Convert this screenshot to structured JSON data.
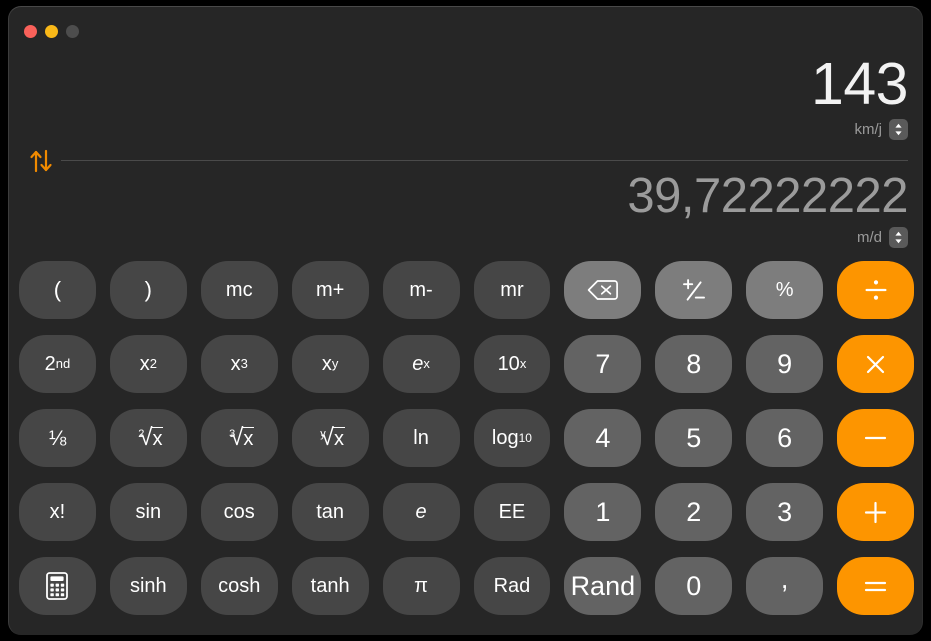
{
  "window": {
    "traffic_lights": [
      {
        "name": "close",
        "color": "#f9615a",
        "label": "Close"
      },
      {
        "name": "minimize",
        "color": "#f9b818",
        "label": "Minimize"
      },
      {
        "name": "zoom",
        "color": "#4d4d4d",
        "label": "Zoom"
      }
    ]
  },
  "display": {
    "primary": {
      "value": "143",
      "unit": "km/j"
    },
    "secondary": {
      "value": "39,72222222",
      "unit": "m/d"
    },
    "swap_icon": "swap-vertical-arrows-icon"
  },
  "colors": {
    "accent_orange": "#fd9500",
    "swap_arrow_orange": "#f08a00",
    "window_background": "#262626",
    "key_function": "#464646",
    "key_utility": "#7d7d7d",
    "key_number": "#636363",
    "primary_text": "#f2f2f2",
    "secondary_text": "#9b9b9b",
    "unit_text": "#9a9a9a"
  },
  "keypad": {
    "rows": [
      [
        {
          "id": "open-paren",
          "label": "(",
          "kind": "fn",
          "style": "paren"
        },
        {
          "id": "close-paren",
          "label": ")",
          "kind": "fn",
          "style": "paren"
        },
        {
          "id": "mc",
          "label": "mc",
          "kind": "fn"
        },
        {
          "id": "m-plus",
          "label": "m+",
          "kind": "fn"
        },
        {
          "id": "m-minus",
          "label": "m-",
          "kind": "fn"
        },
        {
          "id": "mr",
          "label": "mr",
          "kind": "fn"
        },
        {
          "id": "delete",
          "label": "",
          "kind": "util",
          "icon": "backspace-icon"
        },
        {
          "id": "plus-minus",
          "label": "",
          "kind": "util",
          "icon": "plus-minus-icon"
        },
        {
          "id": "percent",
          "label": "%",
          "kind": "util"
        },
        {
          "id": "divide",
          "label": "",
          "kind": "op",
          "icon": "divide-icon"
        }
      ],
      [
        {
          "id": "second",
          "label": "2nd",
          "kind": "fn",
          "base": "2",
          "sup": "nd"
        },
        {
          "id": "x-squared",
          "label": "x2",
          "kind": "fn",
          "base": "x",
          "sup": "2"
        },
        {
          "id": "x-cubed",
          "label": "x3",
          "kind": "fn",
          "base": "x",
          "sup": "3"
        },
        {
          "id": "x-to-y",
          "label": "xy",
          "kind": "fn",
          "base": "x",
          "sup": "y"
        },
        {
          "id": "e-to-x",
          "label": "ex",
          "kind": "fn",
          "base": "e",
          "sup": "x",
          "italic_base": true
        },
        {
          "id": "ten-to-x",
          "label": "10x",
          "kind": "fn",
          "base": "10",
          "sup": "x"
        },
        {
          "id": "seven",
          "label": "7",
          "kind": "num"
        },
        {
          "id": "eight",
          "label": "8",
          "kind": "num"
        },
        {
          "id": "nine",
          "label": "9",
          "kind": "num"
        },
        {
          "id": "multiply",
          "label": "",
          "kind": "op",
          "icon": "multiply-icon"
        }
      ],
      [
        {
          "id": "reciprocal",
          "label": "1/x",
          "kind": "fn",
          "icon": "reciprocal-icon"
        },
        {
          "id": "square-root",
          "label": "2√x",
          "kind": "fn",
          "icon": "root-icon",
          "index": "2"
        },
        {
          "id": "cube-root",
          "label": "3√x",
          "kind": "fn",
          "icon": "root-icon",
          "index": "3"
        },
        {
          "id": "nth-root",
          "label": "y√x",
          "kind": "fn",
          "icon": "root-icon",
          "index": "y"
        },
        {
          "id": "ln",
          "label": "ln",
          "kind": "fn"
        },
        {
          "id": "log10",
          "label": "log10",
          "kind": "fn",
          "base": "log",
          "sub": "10"
        },
        {
          "id": "four",
          "label": "4",
          "kind": "num"
        },
        {
          "id": "five",
          "label": "5",
          "kind": "num"
        },
        {
          "id": "six",
          "label": "6",
          "kind": "num"
        },
        {
          "id": "subtract",
          "label": "",
          "kind": "op",
          "icon": "minus-icon"
        }
      ],
      [
        {
          "id": "factorial",
          "label": "x!",
          "kind": "fn"
        },
        {
          "id": "sin",
          "label": "sin",
          "kind": "fn"
        },
        {
          "id": "cos",
          "label": "cos",
          "kind": "fn"
        },
        {
          "id": "tan",
          "label": "tan",
          "kind": "fn"
        },
        {
          "id": "euler",
          "label": "e",
          "kind": "fn",
          "italic": true
        },
        {
          "id": "ee",
          "label": "EE",
          "kind": "fn"
        },
        {
          "id": "one",
          "label": "1",
          "kind": "num"
        },
        {
          "id": "two",
          "label": "2",
          "kind": "num"
        },
        {
          "id": "three",
          "label": "3",
          "kind": "num"
        },
        {
          "id": "add",
          "label": "",
          "kind": "op",
          "icon": "plus-icon"
        }
      ],
      [
        {
          "id": "basic-mode",
          "label": "",
          "kind": "fn",
          "icon": "calculator-icon"
        },
        {
          "id": "sinh",
          "label": "sinh",
          "kind": "fn"
        },
        {
          "id": "cosh",
          "label": "cosh",
          "kind": "fn"
        },
        {
          "id": "tanh",
          "label": "tanh",
          "kind": "fn"
        },
        {
          "id": "pi",
          "label": "π",
          "kind": "fn"
        },
        {
          "id": "rad",
          "label": "Rad",
          "kind": "fn"
        },
        {
          "id": "rand",
          "label": "Rand",
          "kind": "num"
        },
        {
          "id": "zero",
          "label": "0",
          "kind": "num"
        },
        {
          "id": "decimal",
          "label": ",",
          "kind": "num",
          "style": "comma"
        },
        {
          "id": "equals",
          "label": "",
          "kind": "op",
          "icon": "equals-icon"
        }
      ]
    ]
  }
}
